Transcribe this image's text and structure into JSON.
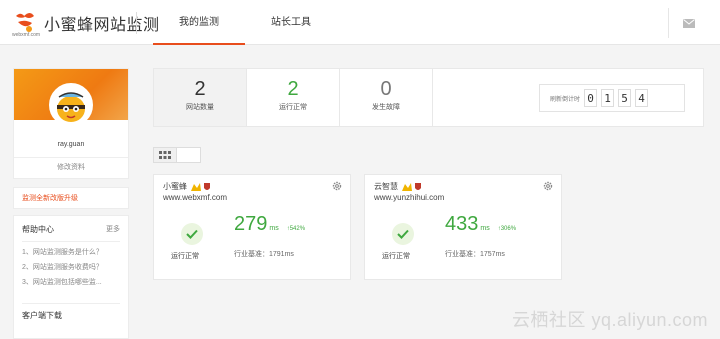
{
  "app": {
    "logo_text": "小蜜蜂网站监测",
    "logo_sub": "webxmf.com"
  },
  "tabs": [
    {
      "label": "我的监测",
      "active": true
    },
    {
      "label": "站长工具",
      "active": false
    }
  ],
  "header": {
    "mail_icon": "mail-icon"
  },
  "sidebar": {
    "username": "ray.guan",
    "edit_profile": "修改资料",
    "promo": "监测全新改版升级",
    "help_title": "帮助中心",
    "help_more": "更多",
    "help_items": [
      "1、网站监测服务是什么？",
      "2、网站监测服务收费吗？",
      "3、网站监测包括哪些监..."
    ],
    "client_download": "客户端下载"
  },
  "stats": {
    "sites": {
      "value": "2",
      "label": "网站数量"
    },
    "running": {
      "value": "2",
      "label": "运行正常"
    },
    "faults": {
      "value": "0",
      "label": "发生故障"
    },
    "timer_label": "刷新倒计时",
    "timer_digits": [
      "0",
      "1",
      "5",
      "4"
    ]
  },
  "colors": {
    "accent": "#e84d1c",
    "ok": "#3fa83f",
    "banner": "#f49a16"
  },
  "sites": [
    {
      "name": "小蜜蜂",
      "url": "www.webxmf.com",
      "status": "运行正常",
      "response": "279",
      "unit": "ms",
      "change": "542%",
      "benchmark": "行业基准：1791ms"
    },
    {
      "name": "云智慧",
      "url": "www.yunzhihui.com",
      "status": "运行正常",
      "response": "433",
      "unit": "ms",
      "change": "306%",
      "benchmark": "行业基准：1757ms"
    }
  ],
  "watermark": "云栖社区 yq.aliyun.com"
}
